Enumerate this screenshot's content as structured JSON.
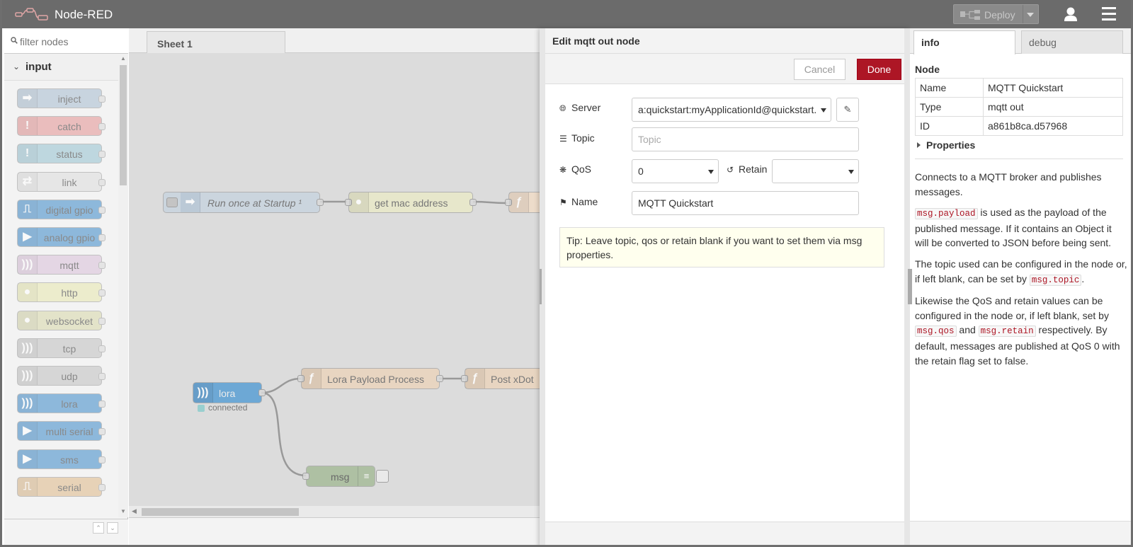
{
  "header": {
    "title": "Node-RED",
    "deploy_label": "Deploy"
  },
  "palette": {
    "filter_placeholder": "filter nodes",
    "category": "input",
    "nodes": [
      {
        "label": "inject",
        "color": "#a6bbcf",
        "icon": "inject-icon"
      },
      {
        "label": "catch",
        "color": "#e49191",
        "icon": "alert-icon"
      },
      {
        "label": "status",
        "color": "#94c1d0",
        "icon": "alert-icon"
      },
      {
        "label": "link",
        "color": "#dddddd",
        "icon": "link-icon"
      },
      {
        "label": "digital gpio",
        "color": "#3a88c9",
        "icon": "pulse-icon"
      },
      {
        "label": "analog gpio",
        "color": "#3a88c9",
        "icon": "arrow-icon"
      },
      {
        "label": "mqtt",
        "color": "#d8bfd8",
        "icon": "wave-icon"
      },
      {
        "label": "http",
        "color": "#e7e7ae",
        "icon": "globe-icon"
      },
      {
        "label": "websocket",
        "color": "#d6d6a8",
        "icon": "globe-icon"
      },
      {
        "label": "tcp",
        "color": "#c0c0c0",
        "icon": "wave-icon"
      },
      {
        "label": "udp",
        "color": "#c0c0c0",
        "icon": "wave-icon"
      },
      {
        "label": "lora",
        "color": "#3a88c9",
        "icon": "wave-icon"
      },
      {
        "label": "multi serial",
        "color": "#3a88c9",
        "icon": "arrow-icon"
      },
      {
        "label": "sms",
        "color": "#3a88c9",
        "icon": "arrow-icon"
      },
      {
        "label": "serial",
        "color": "#deb887",
        "icon": "pulse-icon"
      }
    ]
  },
  "workspace": {
    "tab": "Sheet 1",
    "nodes": {
      "run_once": "Run once at Startup ¹",
      "get_mac": "get mac address",
      "lora": "lora",
      "lora_status": "connected",
      "lora_payload": "Lora Payload Process",
      "post_xdot": "Post xDot",
      "msg": "msg"
    }
  },
  "editor": {
    "title": "Edit mqtt out node",
    "cancel_label": "Cancel",
    "done_label": "Done",
    "server_label": "Server",
    "server_value": "a:quickstart:myApplicationId@quickstart.",
    "topic_label": "Topic",
    "topic_placeholder": "Topic",
    "qos_label": "QoS",
    "qos_value": "0",
    "retain_label": "Retain",
    "retain_value": "",
    "name_label": "Name",
    "name_value": "MQTT Quickstart",
    "tip": "Tip: Leave topic, qos or retain blank if you want to set them via msg properties."
  },
  "sidebar": {
    "tabs": [
      "info",
      "debug"
    ],
    "node_heading": "Node",
    "table": [
      {
        "key": "Name",
        "value": "MQTT Quickstart"
      },
      {
        "key": "Type",
        "value": "mqtt out"
      },
      {
        "key": "ID",
        "value": "a861b8ca.d57968"
      }
    ],
    "properties_label": "Properties",
    "help": {
      "p1": "Connects to a MQTT broker and publishes messages.",
      "p2_code": "msg.payload",
      "p2_text": " is used as the payload of the published message. If it contains an Object it will be converted to JSON before being sent.",
      "p3_text": "The topic used can be configured in the node or, if left blank, can be set by ",
      "p3_code": "msg.topic",
      "p3_end": ".",
      "p4_text": "Likewise the QoS and retain values can be configured in the node or, if left blank, set by ",
      "p4_code1": "msg.qos",
      "p4_and": " and ",
      "p4_code2": "msg.retain",
      "p4_end": " respectively. By default, messages are published at QoS 0 with the retain flag set to false."
    }
  },
  "colors": {
    "header_bg": "#6b6b6b",
    "done_button": "#ad1625",
    "tip_bg": "#ffffee",
    "code_text": "#ad1625"
  }
}
